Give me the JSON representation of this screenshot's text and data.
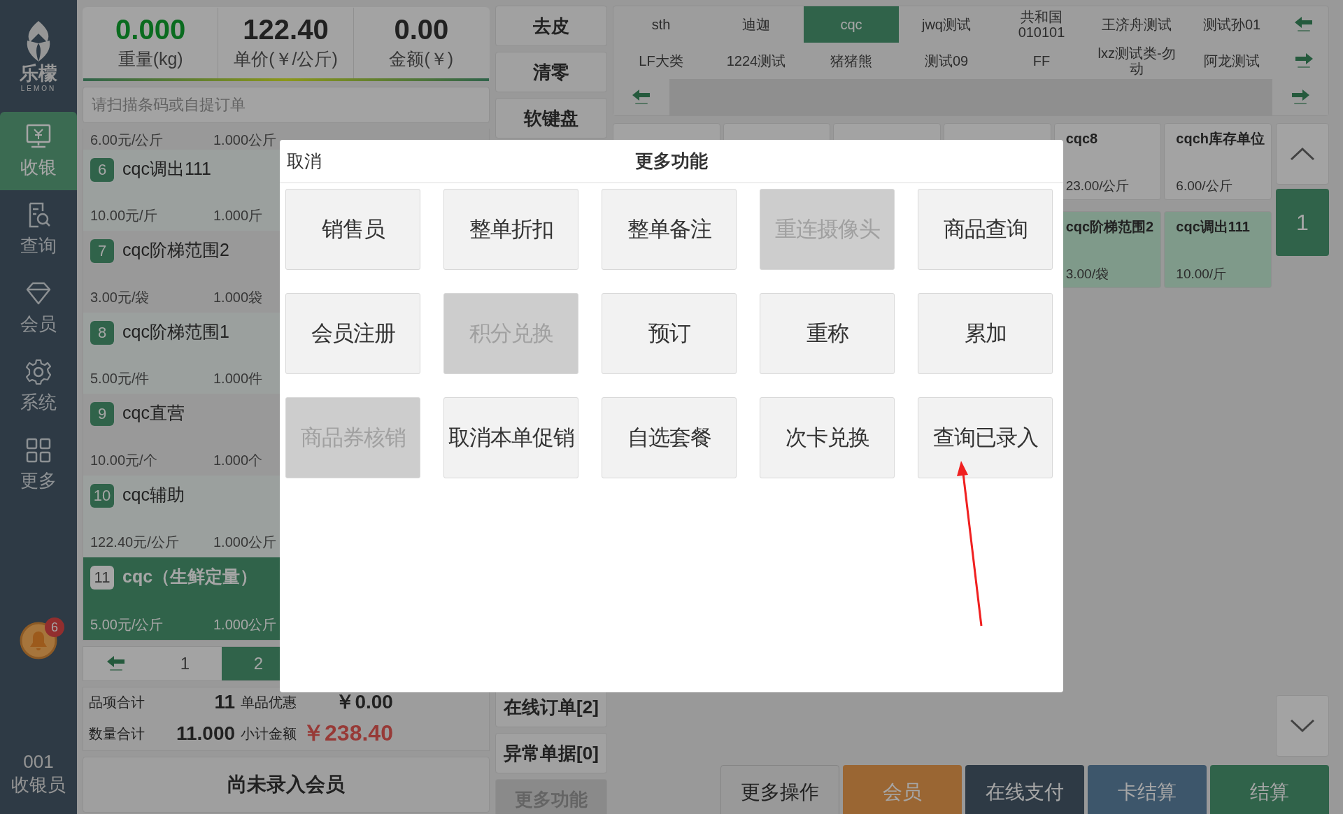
{
  "sidebar": {
    "logo_text": "乐檬",
    "logo_subtext": "LEMON",
    "nav": [
      {
        "label": "收银",
        "selected": true
      },
      {
        "label": "查询",
        "selected": false
      },
      {
        "label": "会员",
        "selected": false
      },
      {
        "label": "系统",
        "selected": false
      },
      {
        "label": "更多",
        "selected": false
      }
    ],
    "notification_count": "6",
    "cashier_id": "001",
    "cashier_role": "收银员"
  },
  "scale": {
    "weight": "0.000",
    "weight_label": "重量(kg)",
    "unit_price": "122.40",
    "unit_price_label": "单价(￥/公斤)",
    "amount": "0.00",
    "amount_label": "金额(￥)"
  },
  "scan_field": {
    "placeholder": "请扫描条码或自提订单"
  },
  "order_items": [
    {
      "kind": "partial",
      "price": "6.00元/公斤",
      "quantity": "1.000公斤",
      "selected": false
    },
    {
      "kind": "item",
      "index": "6",
      "name": "cqc调出111",
      "price": "10.00元/斤",
      "quantity": "1.000斤",
      "selected": false
    },
    {
      "kind": "item",
      "index": "7",
      "name": "cqc阶梯范围2",
      "price": "3.00元/袋",
      "quantity": "1.000袋",
      "selected": false
    },
    {
      "kind": "item",
      "index": "8",
      "name": "cqc阶梯范围1",
      "price": "5.00元/件",
      "quantity": "1.000件",
      "selected": false
    },
    {
      "kind": "item",
      "index": "9",
      "name": "cqc直营",
      "price": "10.00元/个",
      "quantity": "1.000个",
      "selected": false
    },
    {
      "kind": "item",
      "index": "10",
      "name": "cqc辅助",
      "price": "122.40元/公斤",
      "quantity": "1.000公斤",
      "selected": false
    },
    {
      "kind": "item",
      "index": "11",
      "name": "cqc（生鲜定量）",
      "price": "5.00元/公斤",
      "quantity": "1.000公斤",
      "selected": true
    }
  ],
  "pager": {
    "pages": [
      {
        "label": "1",
        "selected": false
      },
      {
        "label": "2",
        "selected": true
      }
    ]
  },
  "totals": {
    "item_count_label": "品项合计",
    "item_count": "11",
    "discount_label": "单品优惠",
    "discount": "￥0.00",
    "quantity_label": "数量合计",
    "quantity": "11.000",
    "subtotal_label": "小计金额",
    "subtotal": "￥238.40"
  },
  "member_button": "尚未录入会员",
  "action_buttons": [
    {
      "label": "去皮",
      "disabled": false
    },
    {
      "label": "清零",
      "disabled": false
    },
    {
      "label": "软键盘",
      "disabled": false
    },
    {
      "label": "在线订单[2]",
      "disabled": false
    },
    {
      "label": "异常单据[0]",
      "disabled": false
    },
    {
      "label": "更多功能",
      "disabled": true
    }
  ],
  "categories": [
    {
      "label": "sth",
      "selected": false
    },
    {
      "label": "迪迦",
      "selected": false
    },
    {
      "label": "cqc",
      "selected": true
    },
    {
      "label": "jwq测试",
      "selected": false
    },
    {
      "label": "共和国010101",
      "selected": false
    },
    {
      "label": "王济舟测试",
      "selected": false
    },
    {
      "label": "测试孙01",
      "selected": false
    },
    {
      "label": "LF大类",
      "selected": false
    },
    {
      "label": "1224测试",
      "selected": false
    },
    {
      "label": "猪猪熊",
      "selected": false
    },
    {
      "label": "测试09",
      "selected": false
    },
    {
      "label": "FF",
      "selected": false
    },
    {
      "label": "lxz测试类-勿动",
      "selected": false
    },
    {
      "label": "阿龙测试",
      "selected": false
    }
  ],
  "products": [
    {
      "name": "cqc8",
      "price": "23.00/公斤",
      "in_cart": false
    },
    {
      "name": "cqch库存单位",
      "price": "6.00/公斤",
      "in_cart": false
    },
    {
      "name": "cqc阶梯范围2",
      "price": "3.00/袋",
      "in_cart": true
    },
    {
      "name": "cqc调出111",
      "price": "10.00/斤",
      "in_cart": true
    }
  ],
  "catalog_page": "1",
  "bottom_buttons": [
    {
      "label": "更多操作",
      "kind": "more"
    },
    {
      "label": "会员",
      "kind": "member"
    },
    {
      "label": "在线支付",
      "kind": "online"
    },
    {
      "label": "卡结算",
      "kind": "card"
    },
    {
      "label": "结算",
      "kind": "checkout"
    }
  ],
  "modal": {
    "cancel": "取消",
    "title": "更多功能",
    "functions": [
      {
        "label": "销售员",
        "disabled": false
      },
      {
        "label": "整单折扣",
        "disabled": false
      },
      {
        "label": "整单备注",
        "disabled": false
      },
      {
        "label": "重连摄像头",
        "disabled": true
      },
      {
        "label": "商品查询",
        "disabled": false
      },
      {
        "label": "会员注册",
        "disabled": false
      },
      {
        "label": "积分兑换",
        "disabled": true
      },
      {
        "label": "预订",
        "disabled": false
      },
      {
        "label": "重称",
        "disabled": false
      },
      {
        "label": "累加",
        "disabled": false
      },
      {
        "label": "商品券核销",
        "disabled": true
      },
      {
        "label": "取消本单促销",
        "disabled": false
      },
      {
        "label": "自选套餐",
        "disabled": false
      },
      {
        "label": "次卡兑换",
        "disabled": false
      },
      {
        "label": "查询已录入",
        "disabled": false
      }
    ]
  }
}
